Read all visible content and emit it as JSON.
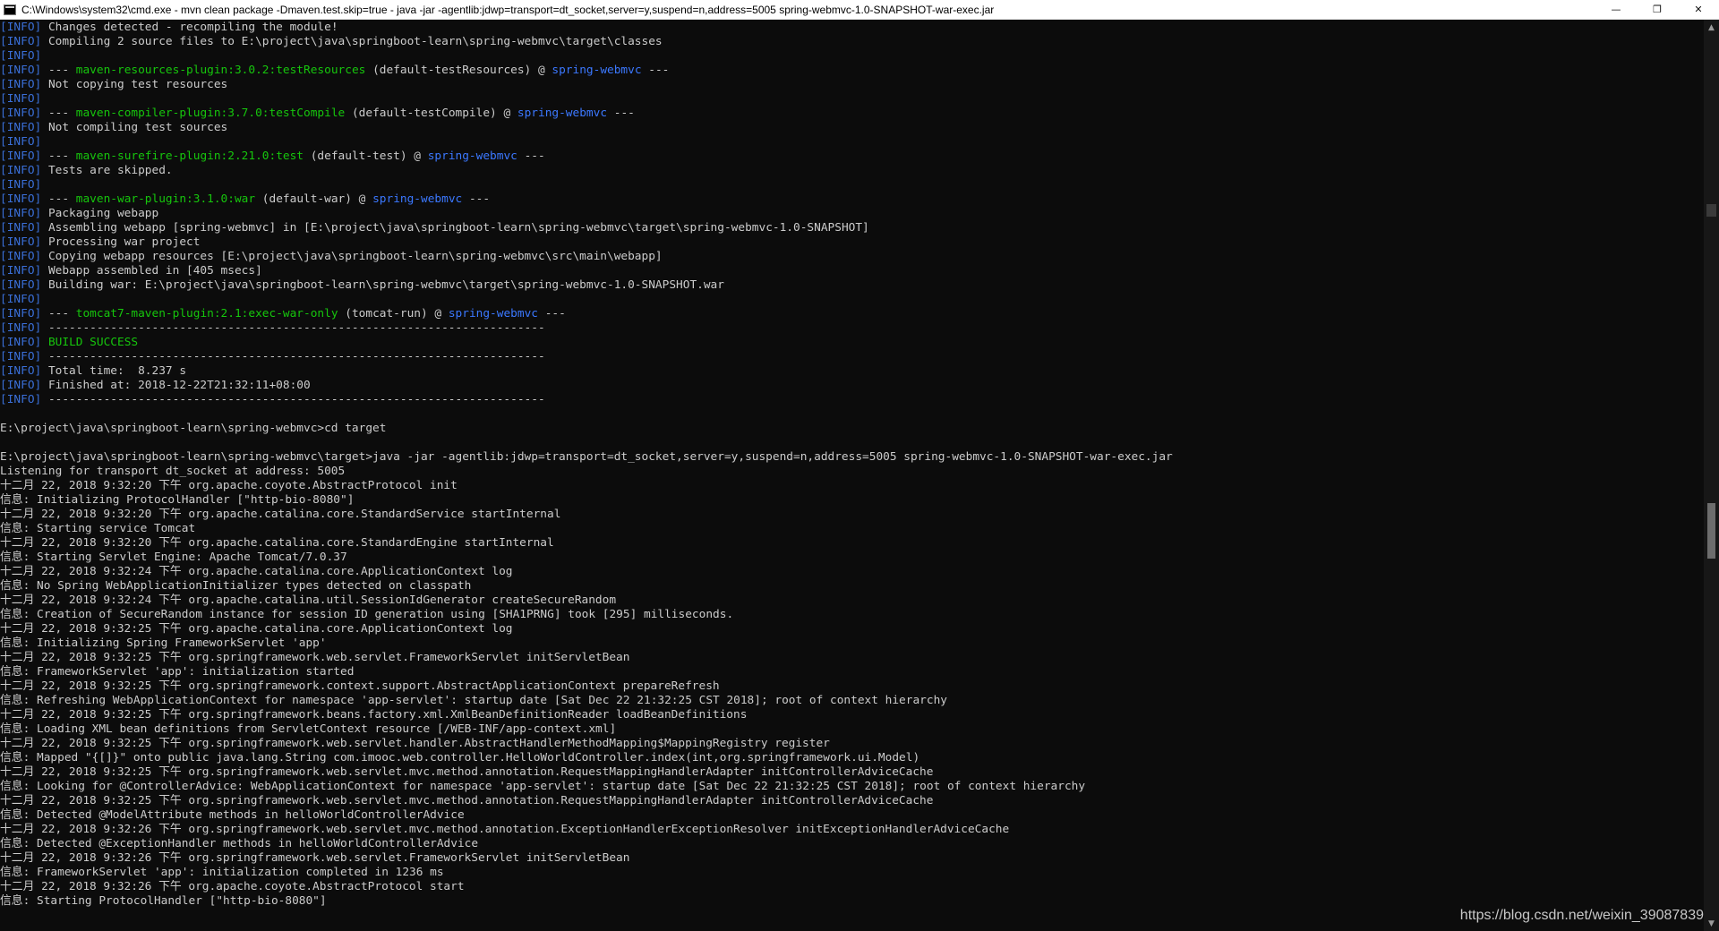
{
  "window": {
    "title": "C:\\Windows\\system32\\cmd.exe - mvn  clean package -Dmaven.test.skip=true - java  -jar -agentlib:jdwp=transport=dt_socket,server=y,suspend=n,address=5005 spring-webmvc-1.0-SNAPSHOT-war-exec.jar",
    "minimize_glyph": "—",
    "maximize_glyph": "❐",
    "close_glyph": "✕"
  },
  "colors": {
    "background": "#0c0c0c",
    "text": "#cccccc",
    "info_tag": "#3a6fd8",
    "plugin_green": "#16c60c",
    "project_cyan": "#3b78ff"
  },
  "console": {
    "lines": [
      [
        {
          "t": "[INFO]",
          "c": "tag"
        },
        {
          "t": " Changes detected - recompiling the module!"
        }
      ],
      [
        {
          "t": "[INFO]",
          "c": "tag"
        },
        {
          "t": " Compiling 2 source files to E:\\project\\java\\springboot-learn\\spring-webmvc\\target\\classes"
        }
      ],
      [
        {
          "t": "[INFO]",
          "c": "tag"
        }
      ],
      [
        {
          "t": "[INFO]",
          "c": "tag"
        },
        {
          "t": " --- "
        },
        {
          "t": "maven-resources-plugin:3.0.2:testResources",
          "c": "green"
        },
        {
          "t": " (default-testResources) @ "
        },
        {
          "t": "spring-webmvc",
          "c": "cyan"
        },
        {
          "t": " ---"
        }
      ],
      [
        {
          "t": "[INFO]",
          "c": "tag"
        },
        {
          "t": " Not copying test resources"
        }
      ],
      [
        {
          "t": "[INFO]",
          "c": "tag"
        }
      ],
      [
        {
          "t": "[INFO]",
          "c": "tag"
        },
        {
          "t": " --- "
        },
        {
          "t": "maven-compiler-plugin:3.7.0:testCompile",
          "c": "green"
        },
        {
          "t": " (default-testCompile) @ "
        },
        {
          "t": "spring-webmvc",
          "c": "cyan"
        },
        {
          "t": " ---"
        }
      ],
      [
        {
          "t": "[INFO]",
          "c": "tag"
        },
        {
          "t": " Not compiling test sources"
        }
      ],
      [
        {
          "t": "[INFO]",
          "c": "tag"
        }
      ],
      [
        {
          "t": "[INFO]",
          "c": "tag"
        },
        {
          "t": " --- "
        },
        {
          "t": "maven-surefire-plugin:2.21.0:test",
          "c": "green"
        },
        {
          "t": " (default-test) @ "
        },
        {
          "t": "spring-webmvc",
          "c": "cyan"
        },
        {
          "t": " ---"
        }
      ],
      [
        {
          "t": "[INFO]",
          "c": "tag"
        },
        {
          "t": " Tests are skipped."
        }
      ],
      [
        {
          "t": "[INFO]",
          "c": "tag"
        }
      ],
      [
        {
          "t": "[INFO]",
          "c": "tag"
        },
        {
          "t": " --- "
        },
        {
          "t": "maven-war-plugin:3.1.0:war",
          "c": "green"
        },
        {
          "t": " (default-war) @ "
        },
        {
          "t": "spring-webmvc",
          "c": "cyan"
        },
        {
          "t": " ---"
        }
      ],
      [
        {
          "t": "[INFO]",
          "c": "tag"
        },
        {
          "t": " Packaging webapp"
        }
      ],
      [
        {
          "t": "[INFO]",
          "c": "tag"
        },
        {
          "t": " Assembling webapp [spring-webmvc] in [E:\\project\\java\\springboot-learn\\spring-webmvc\\target\\spring-webmvc-1.0-SNAPSHOT]"
        }
      ],
      [
        {
          "t": "[INFO]",
          "c": "tag"
        },
        {
          "t": " Processing war project"
        }
      ],
      [
        {
          "t": "[INFO]",
          "c": "tag"
        },
        {
          "t": " Copying webapp resources [E:\\project\\java\\springboot-learn\\spring-webmvc\\src\\main\\webapp]"
        }
      ],
      [
        {
          "t": "[INFO]",
          "c": "tag"
        },
        {
          "t": " Webapp assembled in [405 msecs]"
        }
      ],
      [
        {
          "t": "[INFO]",
          "c": "tag"
        },
        {
          "t": " Building war: E:\\project\\java\\springboot-learn\\spring-webmvc\\target\\spring-webmvc-1.0-SNAPSHOT.war"
        }
      ],
      [
        {
          "t": "[INFO]",
          "c": "tag"
        }
      ],
      [
        {
          "t": "[INFO]",
          "c": "tag"
        },
        {
          "t": " --- "
        },
        {
          "t": "tomcat7-maven-plugin:2.1:exec-war-only",
          "c": "green"
        },
        {
          "t": " (tomcat-run) @ "
        },
        {
          "t": "spring-webmvc",
          "c": "cyan"
        },
        {
          "t": " ---"
        }
      ],
      [
        {
          "t": "[INFO]",
          "c": "tag"
        },
        {
          "t": " ------------------------------------------------------------------------"
        }
      ],
      [
        {
          "t": "[INFO]",
          "c": "tag"
        },
        {
          "t": " "
        },
        {
          "t": "BUILD SUCCESS",
          "c": "green"
        }
      ],
      [
        {
          "t": "[INFO]",
          "c": "tag"
        },
        {
          "t": " ------------------------------------------------------------------------"
        }
      ],
      [
        {
          "t": "[INFO]",
          "c": "tag"
        },
        {
          "t": " Total time:  8.237 s"
        }
      ],
      [
        {
          "t": "[INFO]",
          "c": "tag"
        },
        {
          "t": " Finished at: 2018-12-22T21:32:11+08:00"
        }
      ],
      [
        {
          "t": "[INFO]",
          "c": "tag"
        },
        {
          "t": " ------------------------------------------------------------------------"
        }
      ],
      [],
      [
        {
          "t": "E:\\project\\java\\springboot-learn\\spring-webmvc>cd target"
        }
      ],
      [],
      [
        {
          "t": "E:\\project\\java\\springboot-learn\\spring-webmvc\\target>java -jar -agentlib:jdwp=transport=dt_socket,server=y,suspend=n,address=5005 spring-webmvc-1.0-SNAPSHOT-war-exec.jar"
        }
      ],
      [
        {
          "t": "Listening for transport dt_socket at address: 5005"
        }
      ],
      [
        {
          "t": "十二月 22, 2018 9:32:20 下午 org.apache.coyote.AbstractProtocol init"
        }
      ],
      [
        {
          "t": "信息: Initializing ProtocolHandler [\"http-bio-8080\"]"
        }
      ],
      [
        {
          "t": "十二月 22, 2018 9:32:20 下午 org.apache.catalina.core.StandardService startInternal"
        }
      ],
      [
        {
          "t": "信息: Starting service Tomcat"
        }
      ],
      [
        {
          "t": "十二月 22, 2018 9:32:20 下午 org.apache.catalina.core.StandardEngine startInternal"
        }
      ],
      [
        {
          "t": "信息: Starting Servlet Engine: Apache Tomcat/7.0.37"
        }
      ],
      [
        {
          "t": "十二月 22, 2018 9:32:24 下午 org.apache.catalina.core.ApplicationContext log"
        }
      ],
      [
        {
          "t": "信息: No Spring WebApplicationInitializer types detected on classpath"
        }
      ],
      [
        {
          "t": "十二月 22, 2018 9:32:24 下午 org.apache.catalina.util.SessionIdGenerator createSecureRandom"
        }
      ],
      [
        {
          "t": "信息: Creation of SecureRandom instance for session ID generation using [SHA1PRNG] took [295] milliseconds."
        }
      ],
      [
        {
          "t": "十二月 22, 2018 9:32:25 下午 org.apache.catalina.core.ApplicationContext log"
        }
      ],
      [
        {
          "t": "信息: Initializing Spring FrameworkServlet 'app'"
        }
      ],
      [
        {
          "t": "十二月 22, 2018 9:32:25 下午 org.springframework.web.servlet.FrameworkServlet initServletBean"
        }
      ],
      [
        {
          "t": "信息: FrameworkServlet 'app': initialization started"
        }
      ],
      [
        {
          "t": "十二月 22, 2018 9:32:25 下午 org.springframework.context.support.AbstractApplicationContext prepareRefresh"
        }
      ],
      [
        {
          "t": "信息: Refreshing WebApplicationContext for namespace 'app-servlet': startup date [Sat Dec 22 21:32:25 CST 2018]; root of context hierarchy"
        }
      ],
      [
        {
          "t": "十二月 22, 2018 9:32:25 下午 org.springframework.beans.factory.xml.XmlBeanDefinitionReader loadBeanDefinitions"
        }
      ],
      [
        {
          "t": "信息: Loading XML bean definitions from ServletContext resource [/WEB-INF/app-context.xml]"
        }
      ],
      [
        {
          "t": "十二月 22, 2018 9:32:25 下午 org.springframework.web.servlet.handler.AbstractHandlerMethodMapping$MappingRegistry register"
        }
      ],
      [
        {
          "t": "信息: Mapped \"{[]}\" onto public java.lang.String com.imooc.web.controller.HelloWorldController.index(int,org.springframework.ui.Model)"
        }
      ],
      [
        {
          "t": "十二月 22, 2018 9:32:25 下午 org.springframework.web.servlet.mvc.method.annotation.RequestMappingHandlerAdapter initControllerAdviceCache"
        }
      ],
      [
        {
          "t": "信息: Looking for @ControllerAdvice: WebApplicationContext for namespace 'app-servlet': startup date [Sat Dec 22 21:32:25 CST 2018]; root of context hierarchy"
        }
      ],
      [
        {
          "t": "十二月 22, 2018 9:32:25 下午 org.springframework.web.servlet.mvc.method.annotation.RequestMappingHandlerAdapter initControllerAdviceCache"
        }
      ],
      [
        {
          "t": "信息: Detected @ModelAttribute methods in helloWorldControllerAdvice"
        }
      ],
      [
        {
          "t": "十二月 22, 2018 9:32:26 下午 org.springframework.web.servlet.mvc.method.annotation.ExceptionHandlerExceptionResolver initExceptionHandlerAdviceCache"
        }
      ],
      [
        {
          "t": "信息: Detected @ExceptionHandler methods in helloWorldControllerAdvice"
        }
      ],
      [
        {
          "t": "十二月 22, 2018 9:32:26 下午 org.springframework.web.servlet.FrameworkServlet initServletBean"
        }
      ],
      [
        {
          "t": "信息: FrameworkServlet 'app': initialization completed in 1236 ms"
        }
      ],
      [
        {
          "t": "十二月 22, 2018 9:32:26 下午 org.apache.coyote.AbstractProtocol start"
        }
      ],
      [
        {
          "t": "信息: Starting ProtocolHandler [\"http-bio-8080\"]"
        }
      ]
    ]
  },
  "scrollbar": {
    "up_glyph": "▲",
    "down_glyph": "▼"
  },
  "watermark": "https://blog.csdn.net/weixin_39087839"
}
